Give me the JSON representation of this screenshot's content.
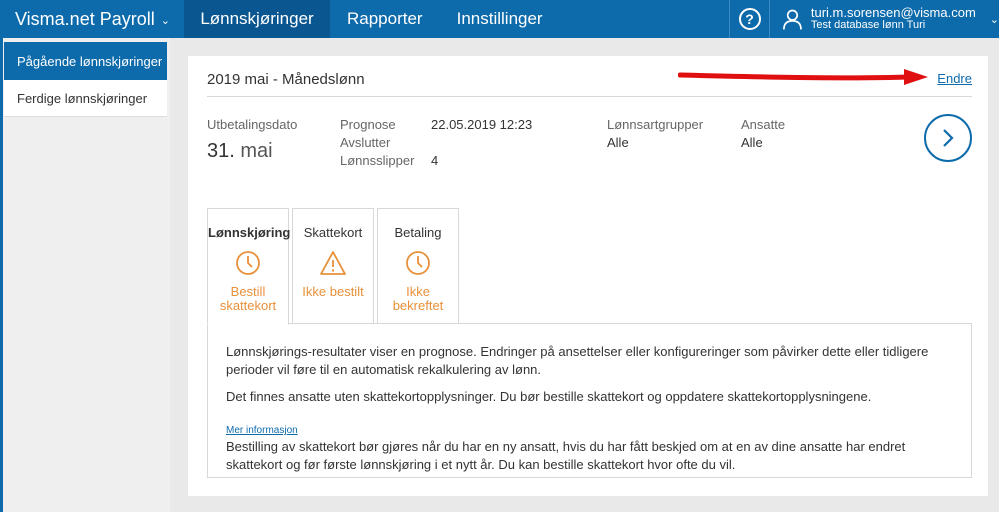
{
  "topbar": {
    "brand": "Visma.net Payroll",
    "nav": [
      "Lønnskjøringer",
      "Rapporter",
      "Innstillinger"
    ],
    "help": "?",
    "user_email": "turi.m.sorensen@visma.com",
    "user_db": "Test database lønn Turi"
  },
  "sidebar": {
    "items": [
      "Pågående lønnskjøringer",
      "Ferdige lønnskjøringer"
    ]
  },
  "card": {
    "title": "2019 mai - Månedslønn",
    "edit": "Endre",
    "payout_label": "Utbetalingsdato",
    "payout_day": "31.",
    "payout_month": "mai",
    "prognose_label": "Prognose",
    "prognose_value": "22.05.2019 12:23",
    "avslutter_label": "Avslutter",
    "slipper_label": "Lønnsslipper",
    "slipper_value": "4",
    "groups_label": "Lønnsartgrupper",
    "groups_value": "Alle",
    "employees_label": "Ansatte",
    "employees_value": "Alle"
  },
  "tabs": [
    {
      "name": "Lønnskjøring",
      "status1": "Bestill",
      "status2": "skattekort"
    },
    {
      "name": "Skattekort",
      "status1": "Ikke bestilt",
      "status2": ""
    },
    {
      "name": "Betaling",
      "status1": "Ikke",
      "status2": "bekreftet"
    }
  ],
  "panel": {
    "p1": "Lønnskjørings-resultater viser en prognose. Endringer på ansettelser eller konfigureringer som påvirker dette eller tidligere perioder vil føre til en automatisk rekalkulering av lønn.",
    "p2": "Det finnes ansatte uten skattekortopplysninger. Du bør bestille skattekort og oppdatere skattekortopplysningene.",
    "more": "Mer informasjon",
    "p3": "Bestilling av skattekort bør gjøres når du har en ny ansatt, hvis du har fått beskjed om at en av dine ansatte har endret skattekort og før første lønnskjøring i et nytt år. Du kan bestille skattekort hvor ofte du vil."
  },
  "colors": {
    "brand_blue": "#0d6aab",
    "warning_orange": "#e8903a",
    "annotation_red": "#e01010"
  }
}
